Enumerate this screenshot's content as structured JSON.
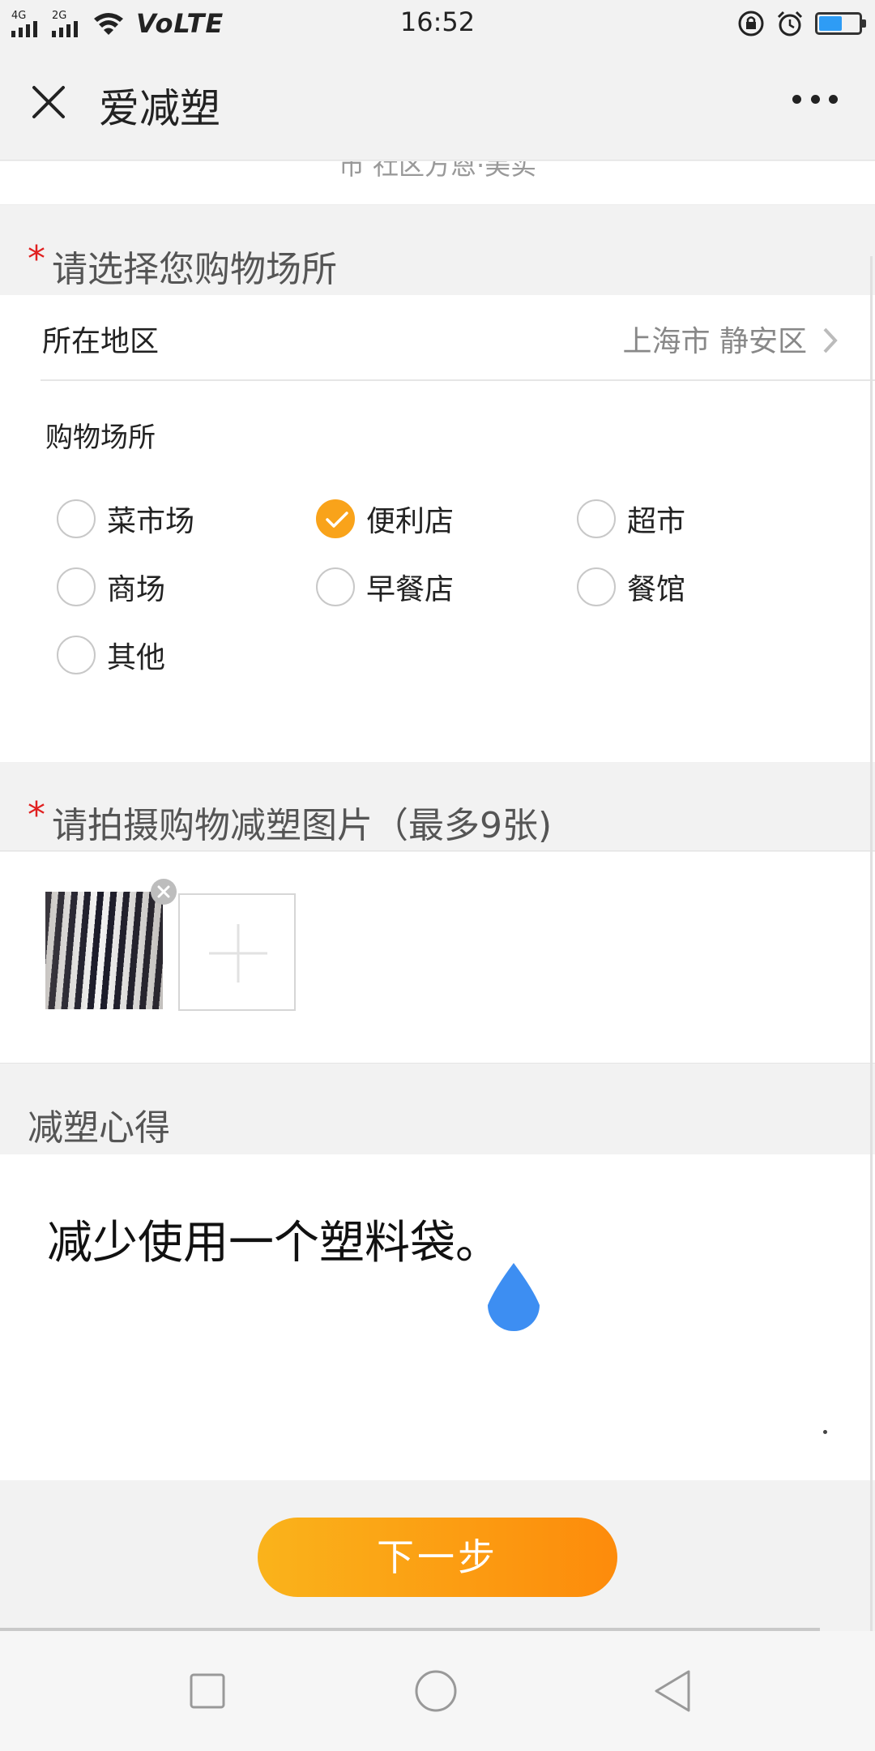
{
  "status_bar": {
    "net1": "4G",
    "net2": "2G",
    "volte": "VoLTE",
    "time": "16:52",
    "battery_level": 0.58
  },
  "header": {
    "title": "爱减塑"
  },
  "remnant_text": "市  社区方恩·美实",
  "shopping_place_section": {
    "title": "请选择您购物场所",
    "region_label": "所在地区",
    "region_value": "上海市 静安区",
    "place_label": "购物场所",
    "options": [
      {
        "label": "菜市场",
        "selected": false
      },
      {
        "label": "便利店",
        "selected": true
      },
      {
        "label": "超市",
        "selected": false
      },
      {
        "label": "商场",
        "selected": false
      },
      {
        "label": "早餐店",
        "selected": false
      },
      {
        "label": "餐馆",
        "selected": false
      },
      {
        "label": "其他",
        "selected": false
      }
    ]
  },
  "photo_section": {
    "title": "请拍摄购物减塑图片（最多9张)"
  },
  "notes_section": {
    "title": "减塑心得",
    "text": "减少使用一个塑料袋。"
  },
  "next_button": "下一步",
  "colors": {
    "accent": "#f9a31a",
    "required": "#e02020",
    "cursor": "#3d8ef2"
  }
}
